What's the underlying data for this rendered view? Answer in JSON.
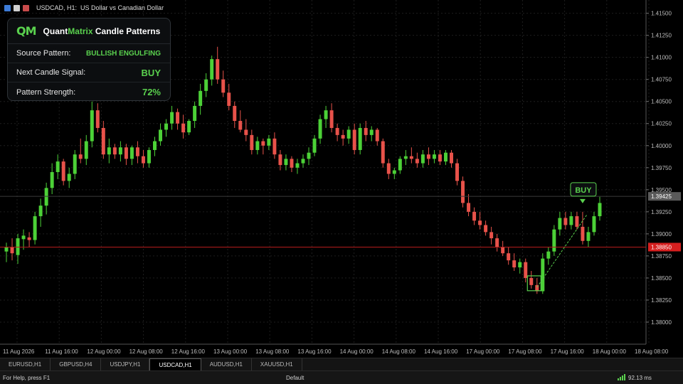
{
  "window": {
    "title": "USDCAD, H1:  US Dollar vs Canadian Dollar"
  },
  "panel": {
    "logo": "QM",
    "title_part1": "Quant",
    "title_part2": "Matrix",
    "title_part3": " Candle Patterns",
    "rows": [
      {
        "label": "Source Pattern:",
        "value": "BULLISH ENGULFING"
      },
      {
        "label": "Next Candle Signal:",
        "value": "BUY"
      },
      {
        "label": "Pattern Strength:",
        "value": "72%"
      }
    ]
  },
  "colors": {
    "bull": "#4cd137",
    "bear": "#e8524a",
    "accent": "#5ad14e",
    "grid": "#1e1e1e",
    "ask_line": "#b51b1b"
  },
  "chart_data": {
    "type": "candlestick",
    "symbol": "USDCAD",
    "timeframe": "H1",
    "ylim": [
      1.3775,
      1.4165
    ],
    "y_ticks": [
      "1.41500",
      "1.41250",
      "1.41000",
      "1.40750",
      "1.40500",
      "1.40250",
      "1.40000",
      "1.39750",
      "1.39500",
      "1.39250",
      "1.39000",
      "1.38750",
      "1.38500",
      "1.38250",
      "1.38000"
    ],
    "x_ticks": [
      "11 Aug 2026",
      "11 Aug 16:00",
      "12 Aug 00:00",
      "12 Aug 08:00",
      "12 Aug 16:00",
      "13 Aug 00:00",
      "13 Aug 08:00",
      "13 Aug 16:00",
      "14 Aug 00:00",
      "14 Aug 08:00",
      "14 Aug 16:00",
      "17 Aug 00:00",
      "17 Aug 08:00",
      "17 Aug 16:00",
      "18 Aug 00:00",
      "18 Aug 08:00"
    ],
    "bid_price": "1.39425",
    "ask_price": "1.38850",
    "signal_label": "BUY",
    "candles": [
      [
        1.388,
        1.389,
        1.3868,
        1.3885
      ],
      [
        1.3885,
        1.3895,
        1.387,
        1.3878
      ],
      [
        1.3876,
        1.39,
        1.3866,
        1.3895
      ],
      [
        1.3894,
        1.3905,
        1.3882,
        1.3898
      ],
      [
        1.3896,
        1.3902,
        1.3885,
        1.3893
      ],
      [
        1.3893,
        1.3925,
        1.3888,
        1.392
      ],
      [
        1.392,
        1.394,
        1.3908,
        1.3932
      ],
      [
        1.3932,
        1.3958,
        1.3922,
        1.3952
      ],
      [
        1.3952,
        1.398,
        1.3945,
        1.397
      ],
      [
        1.397,
        1.399,
        1.3962,
        1.3982
      ],
      [
        1.3982,
        1.3985,
        1.3955,
        1.396
      ],
      [
        1.396,
        1.3975,
        1.3952,
        1.3968
      ],
      [
        1.3968,
        1.3995,
        1.3962,
        1.399
      ],
      [
        1.399,
        1.4008,
        1.398,
        1.3985
      ],
      [
        1.3985,
        1.4012,
        1.3978,
        1.4005
      ],
      [
        1.4005,
        1.405,
        1.3998,
        1.404
      ],
      [
        1.404,
        1.4048,
        1.4015,
        1.402
      ],
      [
        1.402,
        1.4028,
        1.3985,
        1.399
      ],
      [
        1.399,
        1.4008,
        1.398,
        1.3998
      ],
      [
        1.3998,
        1.4002,
        1.3985,
        1.399
      ],
      [
        1.399,
        1.4005,
        1.3982,
        1.3998
      ],
      [
        1.3998,
        1.4002,
        1.3978,
        1.3985
      ],
      [
        1.3985,
        1.4,
        1.3978,
        1.3998
      ],
      [
        1.3998,
        1.4005,
        1.398,
        1.3988
      ],
      [
        1.3988,
        1.3995,
        1.3975,
        1.398
      ],
      [
        1.398,
        1.3998,
        1.3975,
        1.3995
      ],
      [
        1.3995,
        1.401,
        1.3988,
        1.4005
      ],
      [
        1.4005,
        1.4025,
        1.4,
        1.4018
      ],
      [
        1.4018,
        1.403,
        1.401,
        1.4025
      ],
      [
        1.4025,
        1.4045,
        1.4018,
        1.4038
      ],
      [
        1.4038,
        1.4042,
        1.4018,
        1.4025
      ],
      [
        1.4025,
        1.4035,
        1.4008,
        1.4015
      ],
      [
        1.4015,
        1.403,
        1.4012,
        1.4028
      ],
      [
        1.4028,
        1.405,
        1.402,
        1.4045
      ],
      [
        1.4045,
        1.407,
        1.4035,
        1.4062
      ],
      [
        1.4062,
        1.4082,
        1.4055,
        1.4075
      ],
      [
        1.4075,
        1.4102,
        1.4068,
        1.4098
      ],
      [
        1.4098,
        1.4112,
        1.407,
        1.4075
      ],
      [
        1.4075,
        1.4085,
        1.4055,
        1.406
      ],
      [
        1.406,
        1.407,
        1.404,
        1.4045
      ],
      [
        1.4045,
        1.405,
        1.402,
        1.4028
      ],
      [
        1.4028,
        1.404,
        1.4015,
        1.4018
      ],
      [
        1.4018,
        1.403,
        1.4005,
        1.4012
      ],
      [
        1.4012,
        1.4018,
        1.399,
        1.3995
      ],
      [
        1.3995,
        1.401,
        1.399,
        1.4005
      ],
      [
        1.4005,
        1.4008,
        1.399,
        1.4
      ],
      [
        1.4,
        1.4012,
        1.3995,
        1.4008
      ],
      [
        1.4008,
        1.4015,
        1.3985,
        1.399
      ],
      [
        1.399,
        1.3995,
        1.3972,
        1.3978
      ],
      [
        1.3978,
        1.399,
        1.3972,
        1.3985
      ],
      [
        1.3985,
        1.3988,
        1.397,
        1.3975
      ],
      [
        1.3975,
        1.3985,
        1.3968,
        1.398
      ],
      [
        1.398,
        1.399,
        1.3975,
        1.3985
      ],
      [
        1.3985,
        1.3998,
        1.3978,
        1.3992
      ],
      [
        1.3992,
        1.4012,
        1.3988,
        1.4008
      ],
      [
        1.4008,
        1.4035,
        1.4002,
        1.403
      ],
      [
        1.403,
        1.4045,
        1.402,
        1.404
      ],
      [
        1.404,
        1.4048,
        1.4015,
        1.402
      ],
      [
        1.402,
        1.4025,
        1.4005,
        1.4012
      ],
      [
        1.4012,
        1.4018,
        1.4,
        1.4008
      ],
      [
        1.4008,
        1.4022,
        1.4002,
        1.4018
      ],
      [
        1.4018,
        1.4025,
        1.399,
        1.3995
      ],
      [
        1.3995,
        1.4025,
        1.399,
        1.402
      ],
      [
        1.402,
        1.4028,
        1.4005,
        1.4012
      ],
      [
        1.4012,
        1.4022,
        1.4005,
        1.4018
      ],
      [
        1.4018,
        1.402,
        1.4,
        1.4005
      ],
      [
        1.4005,
        1.4008,
        1.3975,
        1.398
      ],
      [
        1.398,
        1.3985,
        1.3962,
        1.3968
      ],
      [
        1.3968,
        1.3975,
        1.3962,
        1.3972
      ],
      [
        1.3972,
        1.3988,
        1.3968,
        1.3985
      ],
      [
        1.3985,
        1.3995,
        1.3978,
        1.3988
      ],
      [
        1.3988,
        1.3998,
        1.398,
        1.3985
      ],
      [
        1.3985,
        1.3992,
        1.3975,
        1.398
      ],
      [
        1.398,
        1.3995,
        1.3975,
        1.399
      ],
      [
        1.399,
        1.3998,
        1.3978,
        1.3985
      ],
      [
        1.3985,
        1.3995,
        1.398,
        1.399
      ],
      [
        1.399,
        1.3995,
        1.3978,
        1.3982
      ],
      [
        1.3982,
        1.3995,
        1.3978,
        1.3992
      ],
      [
        1.3992,
        1.3995,
        1.3975,
        1.398
      ],
      [
        1.398,
        1.3985,
        1.3955,
        1.396
      ],
      [
        1.396,
        1.3965,
        1.393,
        1.3935
      ],
      [
        1.3935,
        1.3945,
        1.392,
        1.3925
      ],
      [
        1.3925,
        1.393,
        1.391,
        1.3915
      ],
      [
        1.3915,
        1.3925,
        1.3905,
        1.391
      ],
      [
        1.391,
        1.3915,
        1.3898,
        1.3902
      ],
      [
        1.3902,
        1.3908,
        1.3888,
        1.3895
      ],
      [
        1.3895,
        1.39,
        1.388,
        1.3885
      ],
      [
        1.3885,
        1.3892,
        1.3875,
        1.3878
      ],
      [
        1.3878,
        1.3885,
        1.3865,
        1.387
      ],
      [
        1.387,
        1.3878,
        1.3858,
        1.3862
      ],
      [
        1.3862,
        1.3872,
        1.3855,
        1.3868
      ],
      [
        1.3868,
        1.3872,
        1.3845,
        1.385
      ],
      [
        1.385,
        1.3858,
        1.3838,
        1.3842
      ],
      [
        1.3842,
        1.385,
        1.3832,
        1.3835
      ],
      [
        1.3835,
        1.3878,
        1.3832,
        1.3872
      ],
      [
        1.3872,
        1.3885,
        1.3865,
        1.388
      ],
      [
        1.388,
        1.391,
        1.3875,
        1.3905
      ],
      [
        1.3905,
        1.3925,
        1.3898,
        1.3918
      ],
      [
        1.3918,
        1.3925,
        1.3905,
        1.391
      ],
      [
        1.391,
        1.3925,
        1.3905,
        1.392
      ],
      [
        1.392,
        1.3925,
        1.3905,
        1.3908
      ],
      [
        1.3908,
        1.3925,
        1.3888,
        1.3892
      ],
      [
        1.3892,
        1.3908,
        1.3885,
        1.3902
      ],
      [
        1.3902,
        1.3925,
        1.3898,
        1.392
      ],
      [
        1.392,
        1.3942,
        1.3915,
        1.3935
      ]
    ]
  },
  "tabs": [
    "EURUSD,H1",
    "GBPUSD,H4",
    "USDJPY,H1",
    "USDCAD,H1",
    "AUDUSD,H1",
    "XAUUSD,H1"
  ],
  "active_tab": "USDCAD,H1",
  "status": {
    "help": "For Help, press F1",
    "profile": "Default",
    "ping": "92.13 ms"
  }
}
